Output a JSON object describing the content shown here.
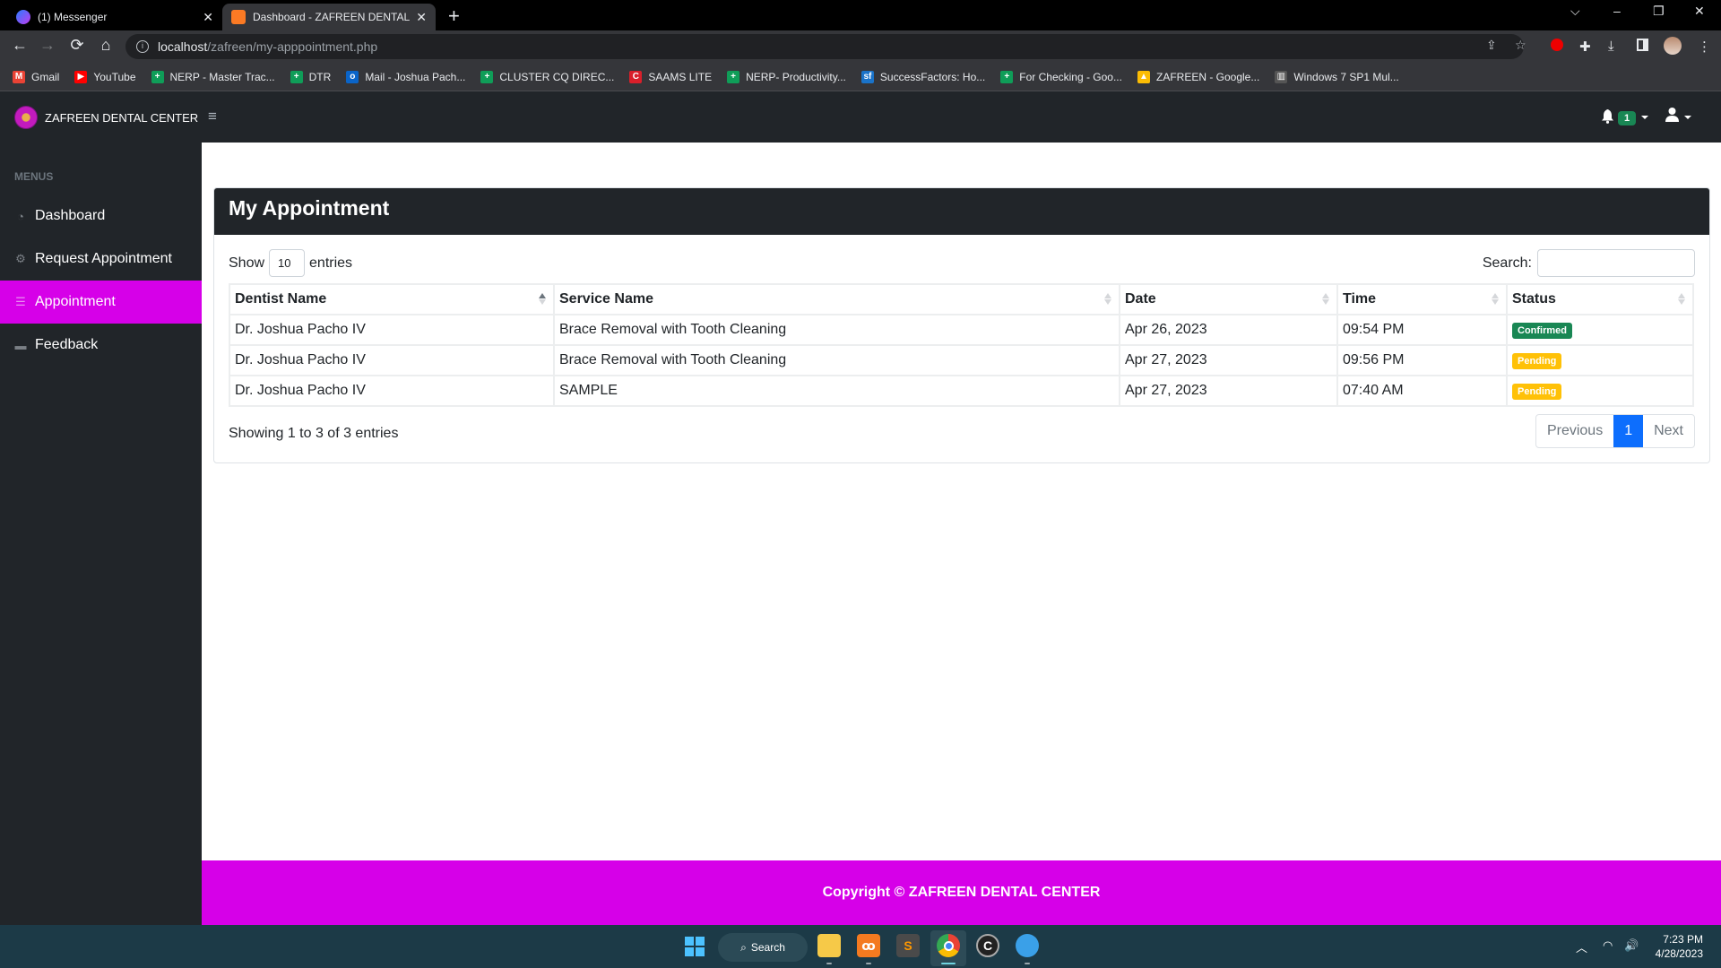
{
  "browser": {
    "tabs": [
      {
        "title": "(1) Messenger",
        "active": false,
        "favicon_color": "#8b5cf6"
      },
      {
        "title": "Dashboard - ZAFREEN DENTAL C",
        "active": true,
        "favicon_color": "#fb7a24"
      }
    ],
    "new_tab_glyph": "+",
    "close_glyph": "✕",
    "window_controls": {
      "tab_search": "⌵",
      "minimize": "–",
      "restore": "❐",
      "close": "✕"
    },
    "nav": {
      "back": "←",
      "forward": "→",
      "reload": "⟳",
      "home": "⌂"
    },
    "url_host": "localhost",
    "url_path": "/zafreen/my-apppointment.php",
    "bookmarks": [
      {
        "label": "Gmail",
        "icon": "gmail-icon",
        "color": "#ea4335",
        "glyph": "M"
      },
      {
        "label": "YouTube",
        "icon": "youtube-icon",
        "color": "#ff0000",
        "glyph": "▶"
      },
      {
        "label": "NERP - Master Trac...",
        "icon": "sheets-icon",
        "color": "#0f9d58",
        "glyph": "+"
      },
      {
        "label": "DTR",
        "icon": "sheets-icon",
        "color": "#0f9d58",
        "glyph": "+"
      },
      {
        "label": "Mail - Joshua Pach...",
        "icon": "outlook-icon",
        "color": "#0a64c8",
        "glyph": "o"
      },
      {
        "label": "CLUSTER CQ DIREC...",
        "icon": "sheets-icon",
        "color": "#0f9d58",
        "glyph": "+"
      },
      {
        "label": "SAAMS LITE",
        "icon": "saams-icon",
        "color": "#d91f2a",
        "glyph": "C"
      },
      {
        "label": "NERP- Productivity...",
        "icon": "sheets-icon",
        "color": "#0f9d58",
        "glyph": "+"
      },
      {
        "label": "SuccessFactors: Ho...",
        "icon": "successfactors-icon",
        "color": "#1a73c9",
        "glyph": "sf"
      },
      {
        "label": "For Checking - Goo...",
        "icon": "sheets-icon",
        "color": "#0f9d58",
        "glyph": "+"
      },
      {
        "label": "ZAFREEN - Google...",
        "icon": "drive-icon",
        "color": "#fbbc04",
        "glyph": "▲"
      },
      {
        "label": "Windows 7 SP1 Mul...",
        "icon": "archive-icon",
        "color": "#555555",
        "glyph": "▥"
      }
    ]
  },
  "app": {
    "brand": "ZAFREEN DENTAL CENTER",
    "hamburger_glyph": "≡",
    "notification_count": "1",
    "bell_glyph": "🔔",
    "user_glyph": "👤"
  },
  "sidebar": {
    "heading": "MENUS",
    "items": [
      {
        "label": "Dashboard",
        "icon": "tachometer-icon",
        "glyph": "◔",
        "active": false
      },
      {
        "label": "Request Appointment",
        "icon": "gear-icon",
        "glyph": "⚙",
        "active": false
      },
      {
        "label": "Appointment",
        "icon": "list-icon",
        "glyph": "☰",
        "active": true
      },
      {
        "label": "Feedback",
        "icon": "comment-icon",
        "glyph": "▬",
        "active": false
      }
    ]
  },
  "main": {
    "title": "My Appointment",
    "show_label": "Show",
    "entries_label": "entries",
    "page_length": "10",
    "search_label": "Search:",
    "search_value": "",
    "columns": [
      "Dentist Name",
      "Service Name",
      "Date",
      "Time",
      "Status"
    ],
    "rows": [
      {
        "dentist": "Dr. Joshua Pacho IV",
        "service": "Brace Removal with Tooth Cleaning",
        "date": "Apr 26, 2023",
        "time": "09:54 PM",
        "status": "Confirmed",
        "status_color": "#198754"
      },
      {
        "dentist": "Dr. Joshua Pacho IV",
        "service": "Brace Removal with Tooth Cleaning",
        "date": "Apr 27, 2023",
        "time": "09:56 PM",
        "status": "Pending",
        "status_color": "#ffc107"
      },
      {
        "dentist": "Dr. Joshua Pacho IV",
        "service": "SAMPLE",
        "date": "Apr 27, 2023",
        "time": "07:40 AM",
        "status": "Pending",
        "status_color": "#ffc107"
      }
    ],
    "info": "Showing 1 to 3 of 3 entries",
    "pagination": {
      "previous": "Previous",
      "current": "1",
      "next": "Next"
    }
  },
  "footer": {
    "text": "Copyright © ZAFREEN DENTAL CENTER",
    "color": "#d600e8"
  },
  "taskbar": {
    "search_label": "Search",
    "time": "7:23 PM",
    "date": "4/28/2023"
  }
}
